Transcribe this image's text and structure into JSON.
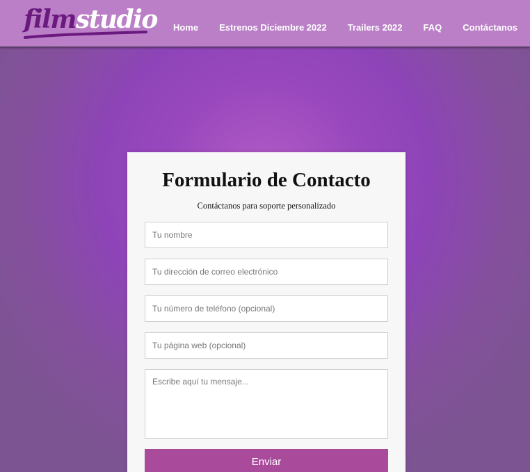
{
  "header": {
    "logo": {
      "part1": "film",
      "part2": "studio"
    },
    "nav": [
      {
        "label": "Home"
      },
      {
        "label": "Estrenos Diciembre 2022"
      },
      {
        "label": "Trailers 2022"
      },
      {
        "label": "FAQ"
      },
      {
        "label": "Contáctanos"
      }
    ]
  },
  "form": {
    "title": "Formulario de Contacto",
    "subtitle": "Contáctanos para soporte personalizado",
    "fields": {
      "name": {
        "placeholder": "Tu nombre",
        "value": ""
      },
      "email": {
        "placeholder": "Tu dirección de correo electrónico",
        "value": ""
      },
      "phone": {
        "placeholder": "Tu número de teléfono (opcional)",
        "value": ""
      },
      "website": {
        "placeholder": "Tu página web (opcional)",
        "value": ""
      },
      "message": {
        "placeholder": "Escribe aquí tu mensaje...",
        "value": ""
      }
    },
    "submit_label": "Enviar"
  },
  "colors": {
    "header_bg": "#ba7fc6",
    "logo_dark": "#6a1a7e",
    "background_purple": "#8e44b8",
    "card_bg": "#f7f7f7",
    "button_bg": "#a94a9b"
  }
}
